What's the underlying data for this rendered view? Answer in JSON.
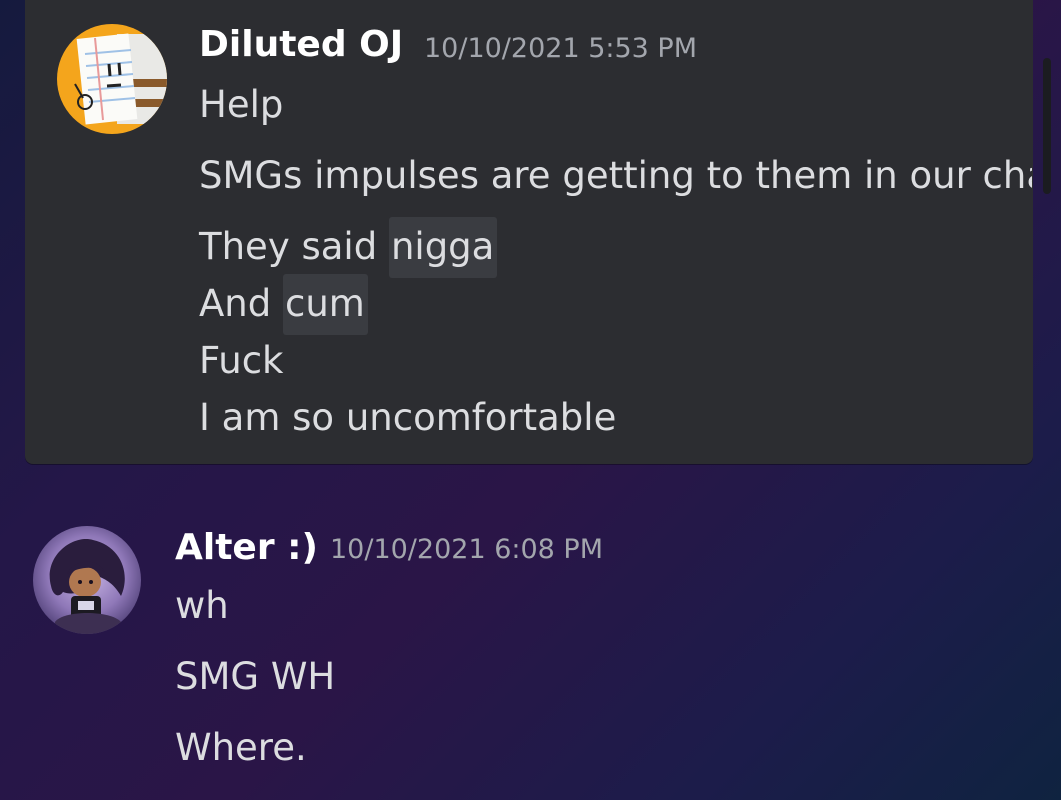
{
  "messages": [
    {
      "author": "Diluted OJ",
      "timestamp": "10/10/2021 5:53 PM",
      "lines": [
        "Help",
        "SMGs impulses are getting to them in our cha",
        "They said",
        "nigga",
        "And",
        "cum",
        "Fuck",
        "I am so uncomfortable"
      ]
    },
    {
      "author": "Alter :)",
      "timestamp": "10/10/2021 6:08 PM",
      "lines": [
        "wh",
        "SMG WH",
        "Where."
      ]
    }
  ],
  "colors": {
    "card_bg": "#2c2d31",
    "author": "#ffffff",
    "timestamp": "#a3a6ad",
    "text": "#dcdde0",
    "highlight_bg": "#3a3c41"
  }
}
